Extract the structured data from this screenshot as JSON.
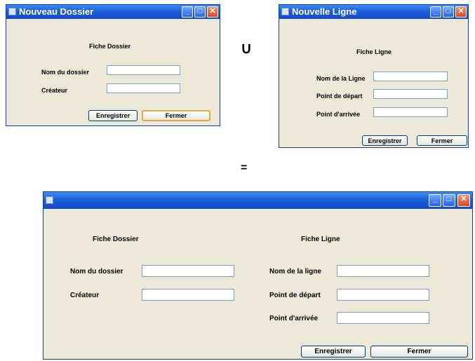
{
  "win1": {
    "title": "Nouveau Dossier",
    "heading": "Fiche Dossier",
    "fields": [
      {
        "label": "Nom du dossier",
        "value": ""
      },
      {
        "label": "Créateur",
        "value": ""
      }
    ],
    "save_label": "Enregistrer",
    "close_label": "Fermer"
  },
  "win2": {
    "title": "Nouvelle Ligne",
    "heading": "Fiche Ligne",
    "fields": [
      {
        "label": "Nom de la Ligne",
        "value": ""
      },
      {
        "label": "Point de départ",
        "value": ""
      },
      {
        "label": "Point d'arrivée",
        "value": ""
      }
    ],
    "save_label": "Enregistrer",
    "close_label": "Fermer"
  },
  "operators": {
    "union": "∪",
    "equals": "="
  },
  "win3": {
    "title": "",
    "heading_left": "Fiche Dossier",
    "heading_right": "Fiche Ligne",
    "left_fields": [
      {
        "label": "Nom du dossier",
        "value": ""
      },
      {
        "label": "Créateur",
        "value": ""
      }
    ],
    "right_fields": [
      {
        "label": "Nom de la ligne",
        "value": ""
      },
      {
        "label": "Point de départ",
        "value": ""
      },
      {
        "label": "Point d'arrivée",
        "value": ""
      }
    ],
    "save_label": "Enregistrer",
    "close_label": "Fermer"
  },
  "titlebar_buttons": {
    "minimize": "_",
    "maximize": "□",
    "close": "✕"
  },
  "colors": {
    "titlebar": "#1d5fd8",
    "window_bg": "#ece9d8",
    "close_btn": "#d84a24"
  }
}
